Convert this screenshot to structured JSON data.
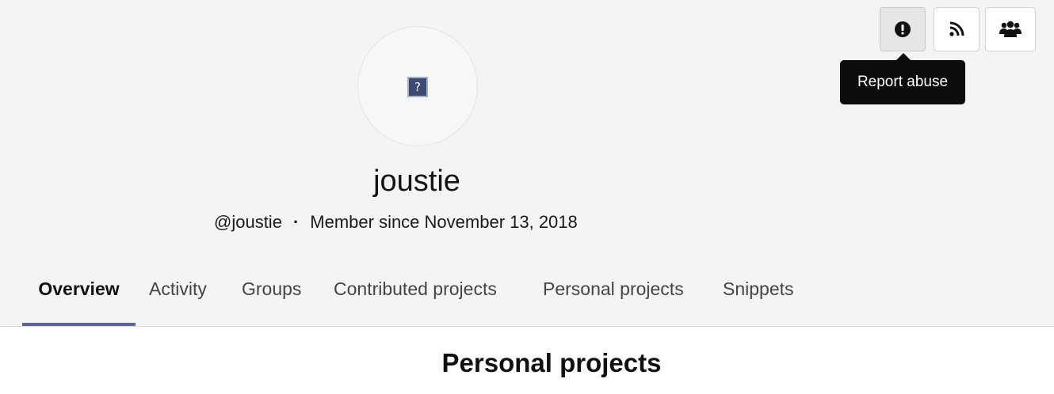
{
  "profile": {
    "name": "joustie",
    "handle": "@joustie",
    "separator": "·",
    "member_since": "Member since November 13, 2018",
    "avatar_placeholder": "?"
  },
  "actions": {
    "report_icon": "exclamation-circle-icon",
    "rss_icon": "rss-icon",
    "users_icon": "users-icon",
    "tooltip": "Report abuse"
  },
  "tabs": [
    {
      "label": "Overview",
      "active": true
    },
    {
      "label": "Activity",
      "active": false
    },
    {
      "label": "Groups",
      "active": false
    },
    {
      "label": "Contributed projects",
      "active": false
    },
    {
      "label": "Personal projects",
      "active": false
    },
    {
      "label": "Snippets",
      "active": false
    }
  ],
  "content": {
    "section_title": "Personal projects"
  },
  "colors": {
    "header_bg": "#f4f4f4",
    "active_tab_underline": "#5a6691",
    "tooltip_bg": "#0c0c0c"
  }
}
